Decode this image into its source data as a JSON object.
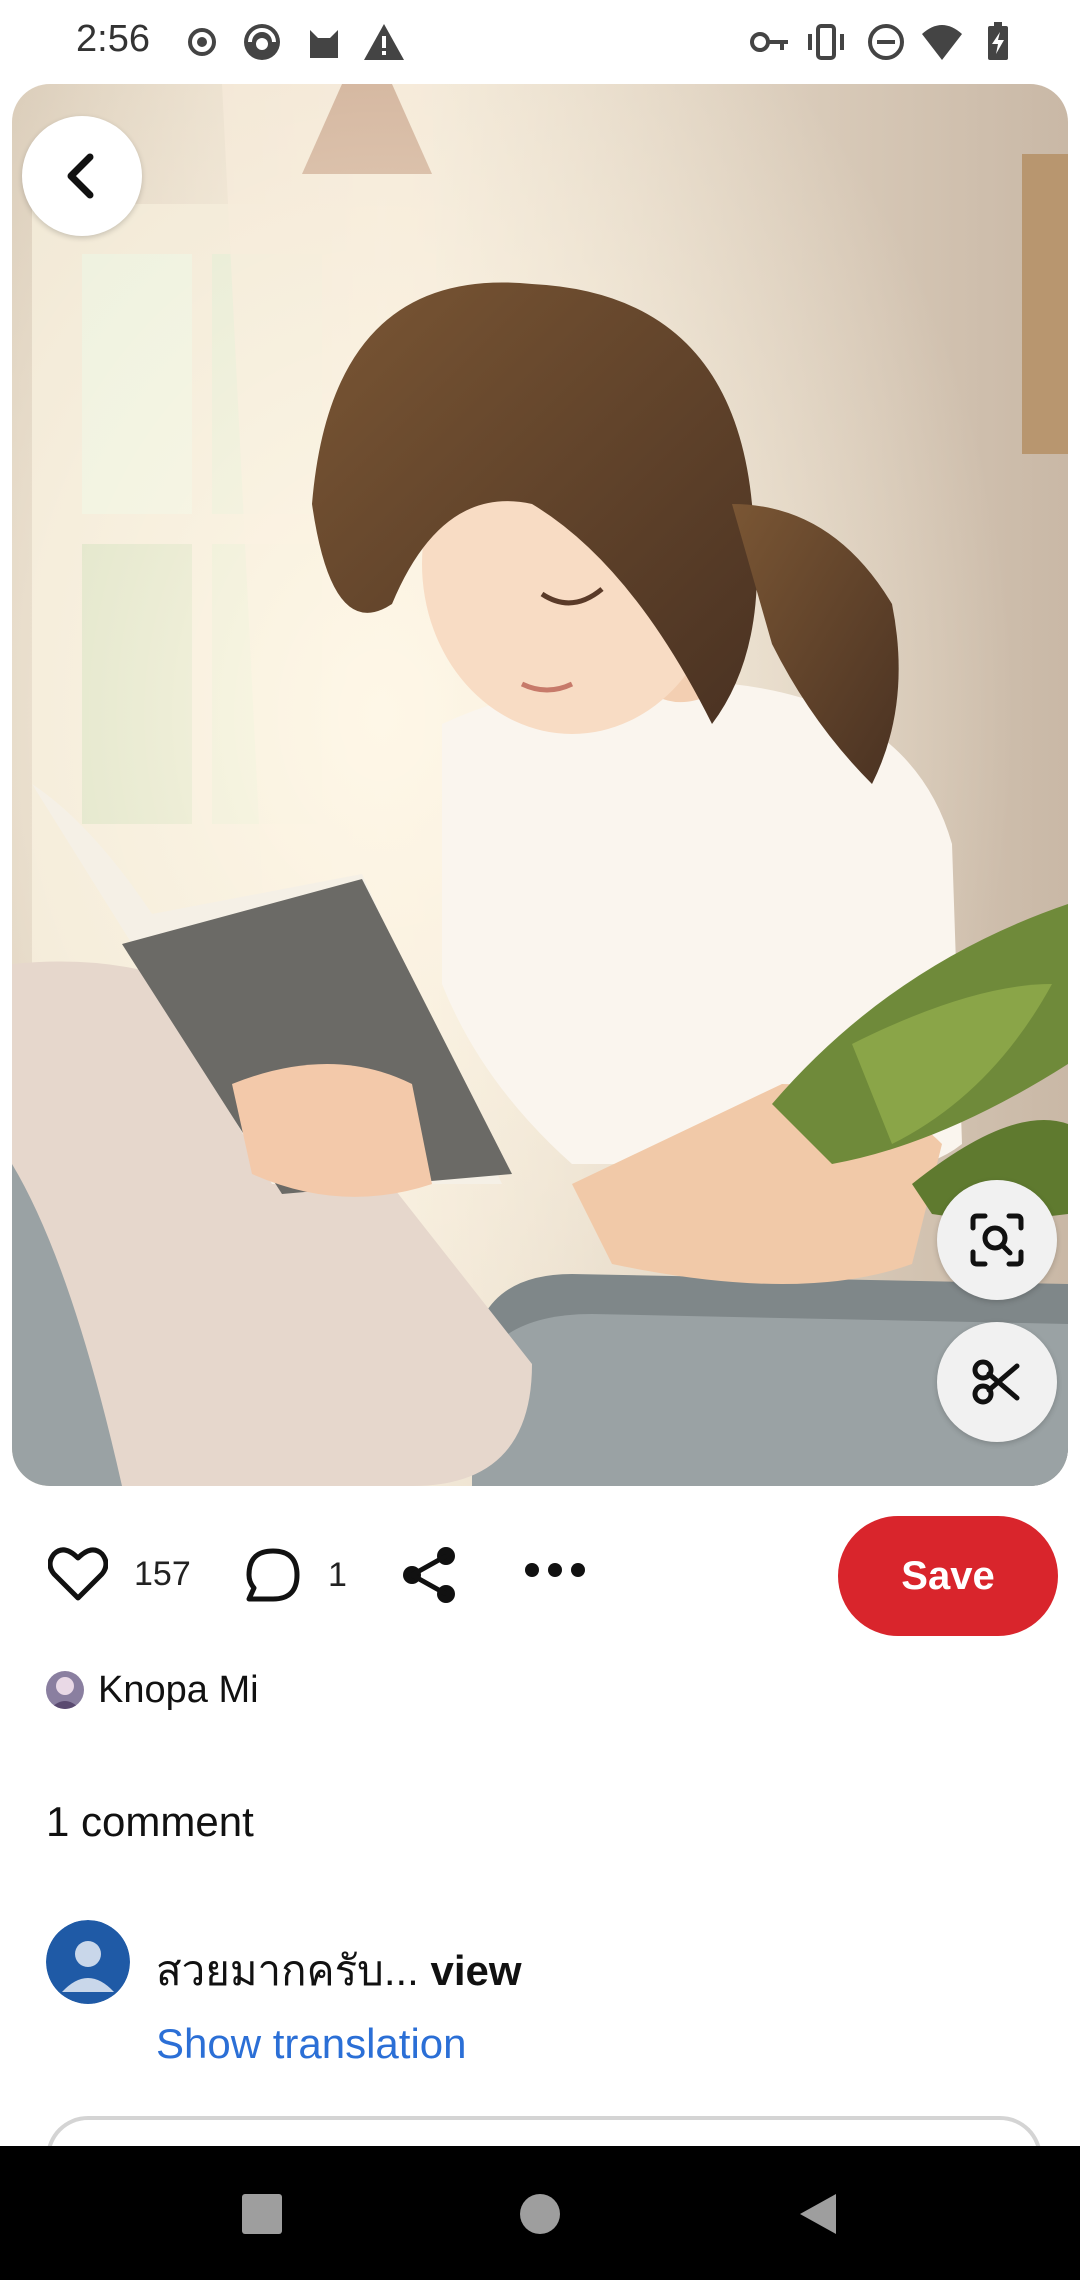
{
  "status_bar": {
    "time": "2:56",
    "left_icons": [
      "record-icon",
      "browser-icon",
      "cat-icon",
      "warning-icon"
    ],
    "right_icons": [
      "vpn-key-icon",
      "vibrate-icon",
      "dnd-icon",
      "wifi-icon",
      "battery-charging-icon"
    ]
  },
  "pin": {
    "image_alt": "illustration-girl-reading",
    "back_icon": "chevron-left-icon",
    "visual_search_icon": "visual-search-icon",
    "cutout_icon": "scissors-icon"
  },
  "actions": {
    "like_count": "157",
    "comment_count": "1",
    "save_label": "Save",
    "save_color": "#d9252c"
  },
  "creator": {
    "name": "Knopa Mi"
  },
  "comments": {
    "title": "1 comment",
    "items": [
      {
        "text": "สวยมากครับ...",
        "view_label": "view",
        "translation_label": "Show translation"
      }
    ]
  },
  "nav": {
    "buttons": [
      "recents-icon",
      "home-icon",
      "back-triangle-icon"
    ]
  }
}
